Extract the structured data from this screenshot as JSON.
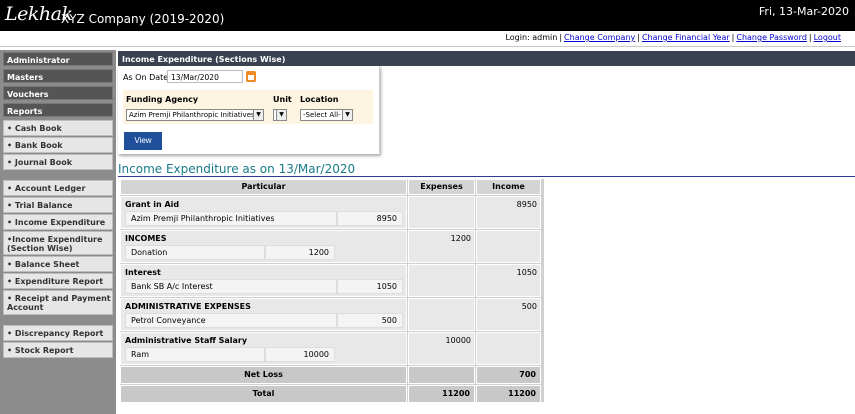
{
  "header": {
    "logo": "Lekhak",
    "company": "XYZ Company (2019-2020)",
    "date": "Fri, 13-Mar-2020"
  },
  "login": {
    "text": "Login: admin",
    "links": [
      "Change Company",
      "Change Financial Year",
      "Change Password",
      "Logout"
    ]
  },
  "sidebar": {
    "heads": [
      "Administrator",
      "Masters",
      "Vouchers",
      "Reports"
    ],
    "items": [
      "• Cash Book",
      "• Bank Book",
      "• Journal Book",
      "• Account Ledger",
      "• Trial Balance",
      "• Income Expenditure",
      "•Income Expenditure (Section Wise)",
      "• Balance Sheet",
      "• Expenditure Report",
      "• Receipt and Payment Account",
      "• Discrepancy Report",
      "• Stock Report"
    ]
  },
  "section": {
    "title": "Income Expenditure (Sections Wise)"
  },
  "filters": {
    "as_on_date_label": "As On Date",
    "as_on_date": "13/Mar/2020",
    "funding_agency_label": "Funding Agency",
    "funding_agency": "Azim Premji Philanthropic Initiatives",
    "unit_label": "Unit",
    "unit": "",
    "location_label": "Location",
    "location": "-Select All-",
    "view_label": "View"
  },
  "report": {
    "title": "Income Expenditure as on 13/Mar/2020",
    "col_particular": "Particular",
    "col_expenses": "Expenses",
    "col_income": "Income",
    "groups": [
      {
        "name": "Grant in Aid",
        "item": "Azim Premji Philanthropic Initiatives",
        "amount": "8950",
        "expenses": "",
        "income": "8950"
      },
      {
        "name": "INCOMES",
        "item": "Donation",
        "amount": "1200",
        "expenses": "1200",
        "income": ""
      },
      {
        "name": "Interest",
        "item": "Bank SB A/c Interest",
        "amount": "1050",
        "expenses": "",
        "income": "1050"
      },
      {
        "name": "ADMINISTRATIVE EXPENSES",
        "item": "Petrol Conveyance",
        "amount": "500",
        "expenses": "",
        "income": "500"
      },
      {
        "name": "Administrative Staff Salary",
        "item": "Ram",
        "amount": "10000",
        "expenses": "10000",
        "income": ""
      }
    ],
    "net_loss_label": "Net Loss",
    "net_loss_expenses": "",
    "net_loss_income": "700",
    "total_label": "Total",
    "total_expenses": "11200",
    "total_income": "11200"
  }
}
